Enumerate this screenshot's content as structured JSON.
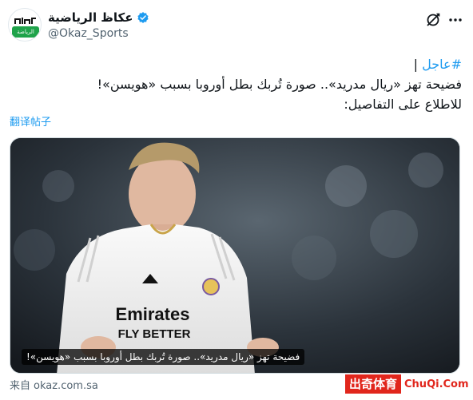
{
  "account": {
    "display_name": "عكاظ الرياضية",
    "handle": "@Okaz_Sports",
    "logo_text": "الرياضة",
    "verified_color": "#1d9bf0"
  },
  "tweet": {
    "hashtag": "#عاجل",
    "separator": " |",
    "line1": "فضيحة تهز «ريال مدريد».. صورة تُربك بطل أوروبا بسبب «هويسن»!",
    "line2": "للاطلاع على التفاصيل:"
  },
  "translate_label": "翻译帖子",
  "media": {
    "caption": "فضيحة تهز «ريال مدريد».. صورة تُربك بطل أوروبا بسبب «هويسن»!",
    "shirt_sponsor_line1": "Emirates",
    "shirt_sponsor_line2": "FLY BETTER"
  },
  "source": {
    "prefix": "来自",
    "domain": "okaz.com.sa"
  },
  "watermark": {
    "badge": "出奇体育",
    "url": "ChuQi.Com",
    "color": "#e1261c"
  },
  "icons": {
    "grok": "grok-icon",
    "more": "more-icon",
    "verified": "verified-badge-icon"
  }
}
